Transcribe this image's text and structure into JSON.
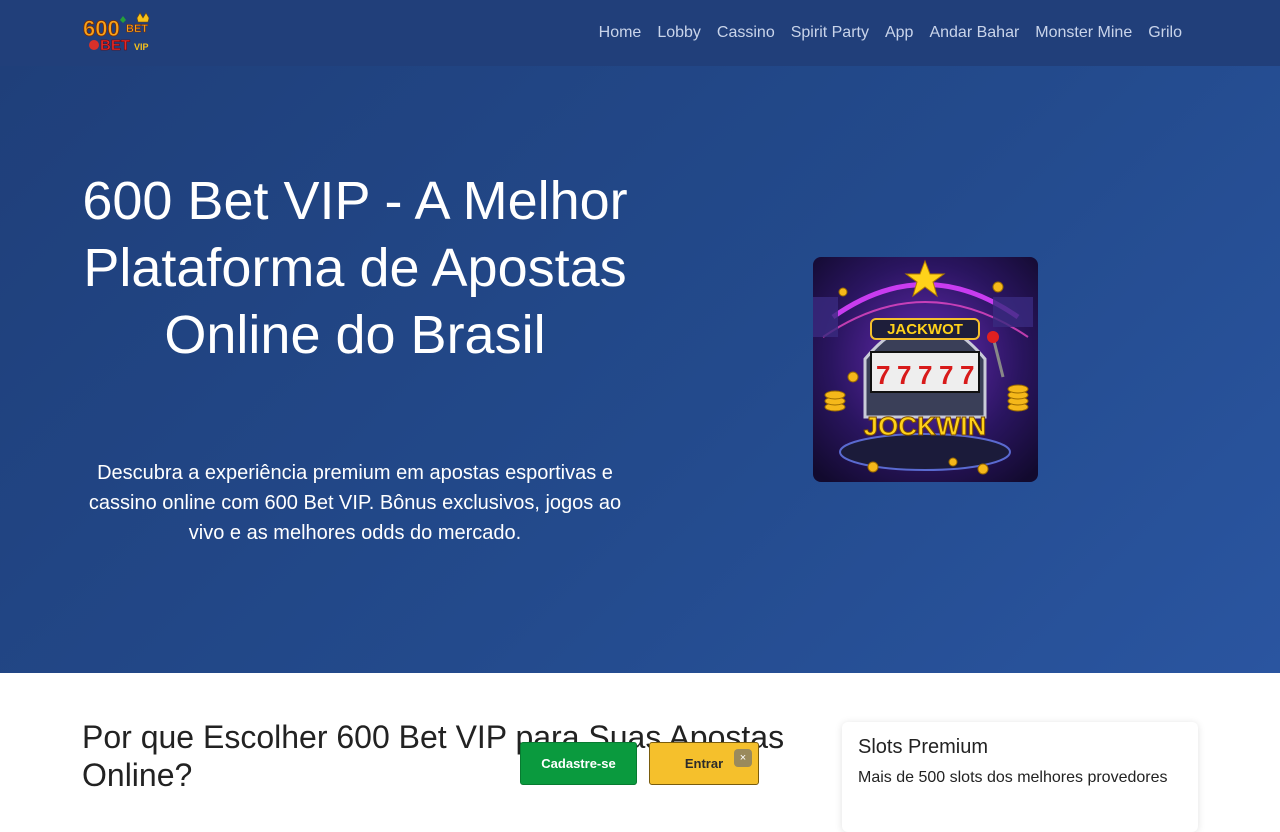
{
  "nav": {
    "logo_alt": "600 BET VIP",
    "items": [
      {
        "label": "Home"
      },
      {
        "label": "Lobby"
      },
      {
        "label": "Cassino"
      },
      {
        "label": "Spirit Party"
      },
      {
        "label": "App"
      },
      {
        "label": "Andar Bahar"
      },
      {
        "label": "Monster Mine"
      },
      {
        "label": "Grilo"
      }
    ]
  },
  "hero": {
    "title": "600 Bet VIP - A Melhor Plataforma de Apostas Online do Brasil",
    "description": "Descubra a experiência premium em apostas esportivas e cassino online com 600 Bet VIP. Bônus exclusivos, jogos ao vivo e as melhores odds do mercado.",
    "image_text_top": "JACKWOT",
    "image_text_bottom": "JOCKWIN"
  },
  "section": {
    "title": "Por que Escolher 600 Bet VIP para Suas Apostas Online?"
  },
  "card": {
    "title": "Slots Premium",
    "text": "Mais de 500 slots dos melhores provedores"
  },
  "sticky": {
    "signup_label": "Cadastre-se",
    "login_label": "Entrar",
    "close_label": "×"
  },
  "colors": {
    "nav_bg": "#213f7a",
    "hero_bg": "#234a8c",
    "signup": "#0a9a3e",
    "login": "#f5c02c"
  }
}
